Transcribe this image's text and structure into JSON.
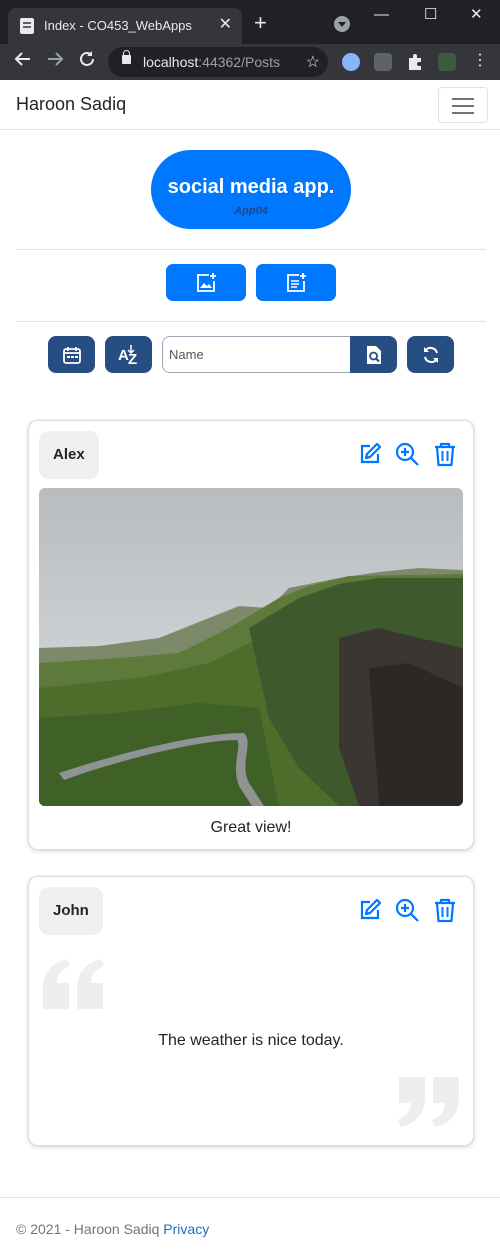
{
  "browser": {
    "tab_title": "Index - CO453_WebApps",
    "tab_close": "✕",
    "new_tab": "+",
    "url_host": "localhost",
    "url_rest": ":44362/Posts",
    "min": "—",
    "max": "☐",
    "close": "✕"
  },
  "navbar": {
    "brand": "Haroon Sadiq"
  },
  "logo": {
    "title": "social media app.",
    "subtitle": "App04"
  },
  "search": {
    "placeholder": "Name"
  },
  "posts": [
    {
      "author": "Alex",
      "caption": "Great view!",
      "type": "photo"
    },
    {
      "author": "John",
      "caption": "The weather is nice today.",
      "type": "message"
    }
  ],
  "footer": {
    "copyright": "© 2021 - Haroon Sadiq",
    "privacy": "Privacy"
  },
  "colors": {
    "accent": "#0077ff",
    "dark_button": "#274e82"
  },
  "icons": {
    "add_photo": "add-photo-icon",
    "add_message": "add-message-icon",
    "calendar": "calendar-icon",
    "sort": "sort-az-icon",
    "search": "search-icon",
    "refresh": "refresh-icon",
    "edit": "edit-icon",
    "zoom": "zoom-in-icon",
    "delete": "trash-icon"
  }
}
